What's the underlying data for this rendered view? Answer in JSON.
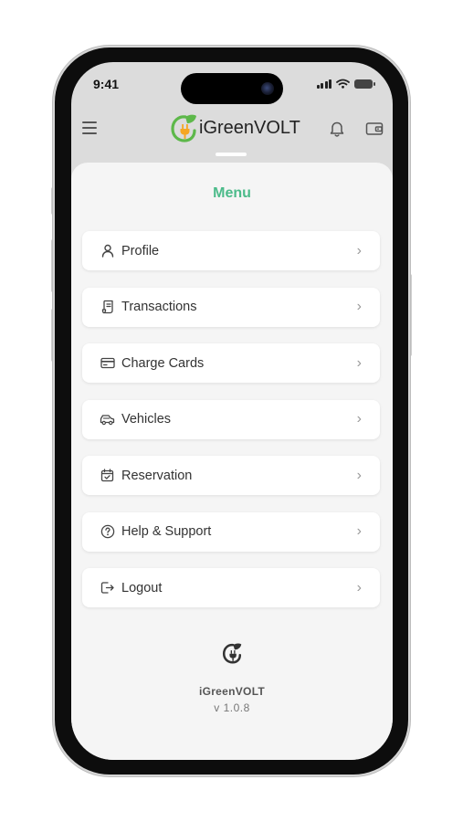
{
  "status_bar": {
    "time": "9:41"
  },
  "app_bar": {
    "brand_name": "iGreenVOLT"
  },
  "sheet": {
    "title": "Menu",
    "items": [
      {
        "label": "Profile",
        "icon": "person-icon"
      },
      {
        "label": "Transactions",
        "icon": "receipt-icon"
      },
      {
        "label": "Charge Cards",
        "icon": "card-icon"
      },
      {
        "label": "Vehicles",
        "icon": "car-icon"
      },
      {
        "label": "Reservation",
        "icon": "calendar-check-icon"
      },
      {
        "label": "Help & Support",
        "icon": "help-circle-icon"
      },
      {
        "label": "Logout",
        "icon": "logout-icon"
      }
    ]
  },
  "footer": {
    "app_name": "iGreenVOLT",
    "version": "v 1.0.8"
  },
  "colors": {
    "accent": "#4cbb8a",
    "logo_green": "#5db84a",
    "logo_orange": "#f5a623"
  }
}
